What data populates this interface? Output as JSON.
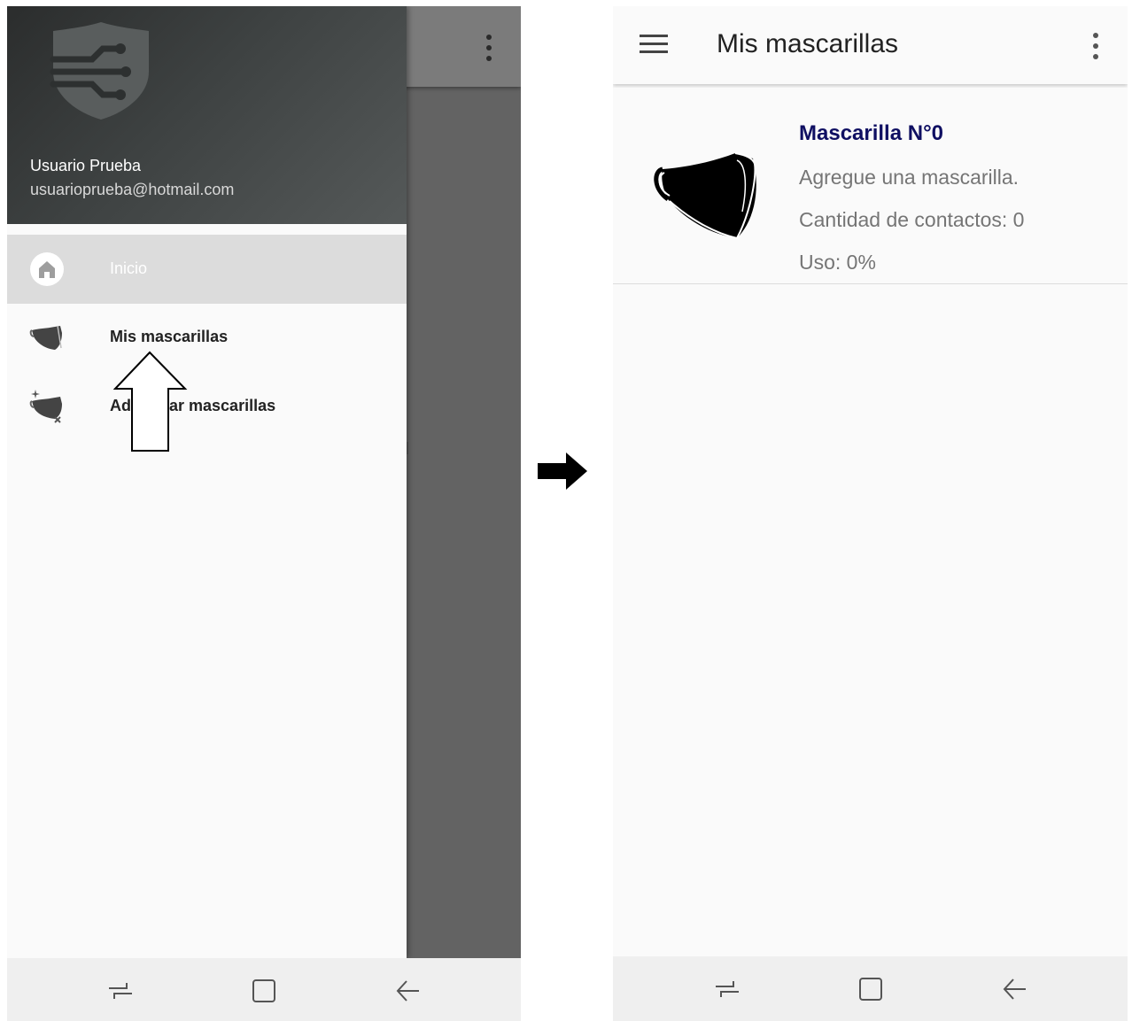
{
  "left_screen": {
    "drawer": {
      "user_name": "Usuario Prueba",
      "user_email": "usuarioprueba@hotmail.com",
      "items": [
        {
          "label": "Inicio",
          "icon": "home-icon",
          "selected": true
        },
        {
          "label": "Mis mascarillas",
          "icon": "mask-icon",
          "selected": false
        },
        {
          "label": "Ad    strar mascarillas",
          "icon": "mask-settings-icon",
          "selected": false
        }
      ]
    },
    "overflow_icon": "more-vert-icon"
  },
  "transition_icon": "arrow-right-icon",
  "right_screen": {
    "appbar": {
      "title": "Mis mascarillas",
      "menu_icon": "menu-icon",
      "overflow_icon": "more-vert-icon"
    },
    "mask_card": {
      "title": "Mascarilla N°0",
      "description": "Agregue una mascarilla.",
      "contacts": "Cantidad de contactos: 0",
      "usage": "Uso: 0%",
      "title_color": "#0f0f62"
    }
  },
  "navbar_icons": [
    "recent-apps-icon",
    "home-button-icon",
    "back-icon"
  ]
}
